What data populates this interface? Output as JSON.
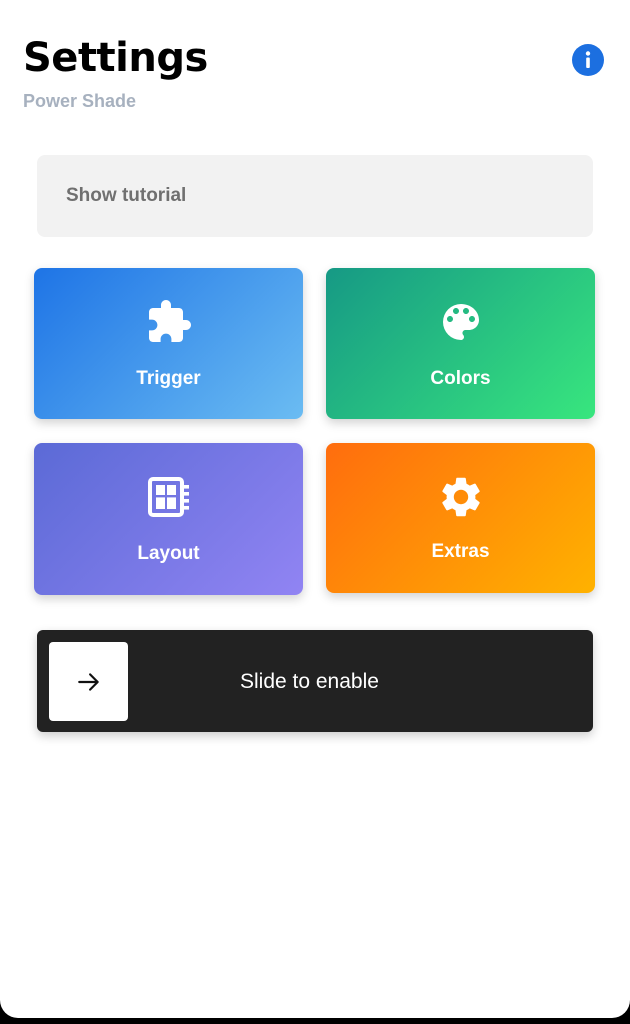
{
  "header": {
    "title": "Settings",
    "subtitle": "Power Shade",
    "info_icon": "info-icon"
  },
  "tutorial": {
    "label": "Show tutorial"
  },
  "tiles": [
    {
      "label": "Trigger",
      "icon": "puzzle-icon",
      "gradient": [
        "#1e74e6",
        "#6bbcf2"
      ]
    },
    {
      "label": "Colors",
      "icon": "palette-icon",
      "gradient": [
        "#169985",
        "#38e67e"
      ]
    },
    {
      "label": "Layout",
      "icon": "layout-icon",
      "gradient": [
        "#5b6ad6",
        "#9184f3"
      ]
    },
    {
      "label": "Extras",
      "icon": "gear-icon",
      "gradient": [
        "#ff6d0e",
        "#ffb200"
      ]
    }
  ],
  "slider": {
    "label": "Slide to enable",
    "handle_icon": "arrow-right-icon"
  },
  "colors": {
    "accent": "#1c6fe0",
    "subtitle": "#a7b1bf",
    "slider_bg": "#222222"
  }
}
